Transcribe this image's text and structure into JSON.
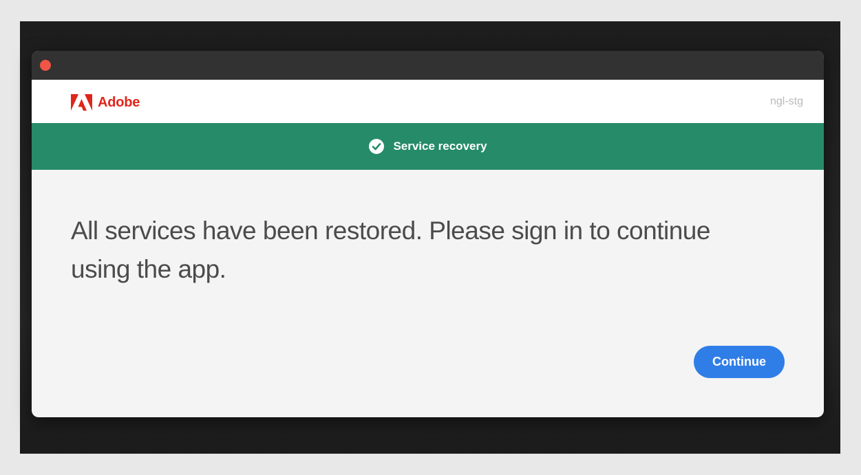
{
  "window": {
    "close_control_color": "#f05545"
  },
  "header": {
    "brand": "Adobe",
    "brand_color": "#e1251b",
    "logo_icon": "adobe-logo-icon",
    "environment_tag": "ngl-stg"
  },
  "banner": {
    "icon": "check-circle-icon",
    "title": "Service recovery",
    "color": "#268b68"
  },
  "main": {
    "message": "All services have been restored. Please sign in to continue using the app."
  },
  "actions": {
    "continue_label": "Continue",
    "continue_color": "#2f7ee8"
  }
}
